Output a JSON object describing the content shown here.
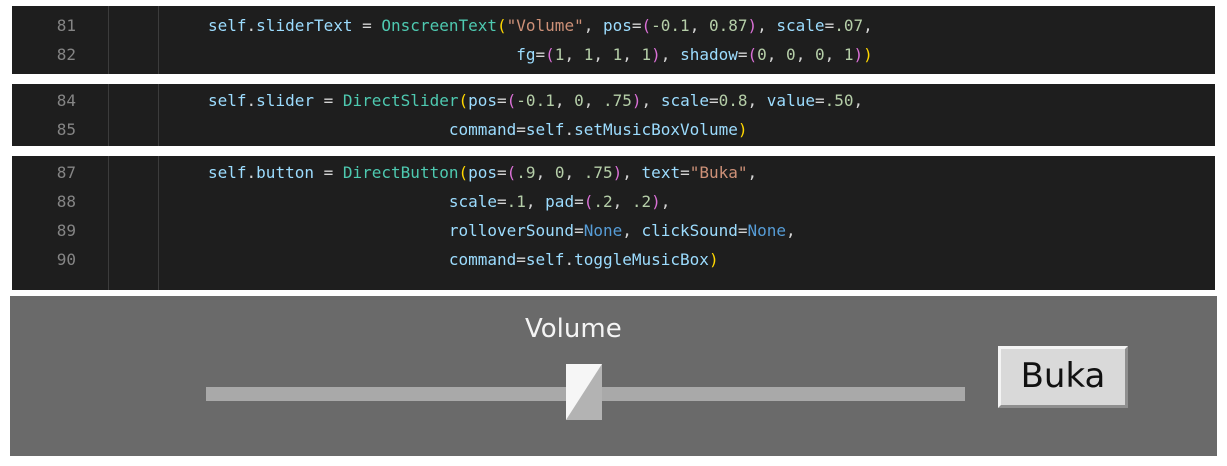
{
  "code_panels": [
    {
      "lines": [
        {
          "num": "81",
          "tokens": [
            [
              "self",
              "var"
            ],
            [
              ".",
              "op"
            ],
            [
              "sliderText",
              "var"
            ],
            [
              " = ",
              "op"
            ],
            [
              "OnscreenText",
              "cls"
            ],
            [
              "(",
              "p1"
            ],
            [
              "\"Volume\"",
              "str"
            ],
            [
              ", ",
              "op"
            ],
            [
              "pos",
              "var"
            ],
            [
              "=",
              "op"
            ],
            [
              "(",
              "p2"
            ],
            [
              "-0.1",
              "num"
            ],
            [
              ", ",
              "op"
            ],
            [
              "0.87",
              "num"
            ],
            [
              ")",
              "p2"
            ],
            [
              ", ",
              "op"
            ],
            [
              "scale",
              "var"
            ],
            [
              "=",
              "op"
            ],
            [
              ".07",
              "num"
            ],
            [
              ",",
              "op"
            ]
          ]
        },
        {
          "num": "82",
          "tokens": [
            [
              "                                ",
              "op"
            ],
            [
              "fg",
              "var"
            ],
            [
              "=",
              "op"
            ],
            [
              "(",
              "p2"
            ],
            [
              "1",
              "num"
            ],
            [
              ", ",
              "op"
            ],
            [
              "1",
              "num"
            ],
            [
              ", ",
              "op"
            ],
            [
              "1",
              "num"
            ],
            [
              ", ",
              "op"
            ],
            [
              "1",
              "num"
            ],
            [
              ")",
              "p2"
            ],
            [
              ", ",
              "op"
            ],
            [
              "shadow",
              "var"
            ],
            [
              "=",
              "op"
            ],
            [
              "(",
              "p2"
            ],
            [
              "0",
              "num"
            ],
            [
              ", ",
              "op"
            ],
            [
              "0",
              "num"
            ],
            [
              ", ",
              "op"
            ],
            [
              "0",
              "num"
            ],
            [
              ", ",
              "op"
            ],
            [
              "1",
              "num"
            ],
            [
              ")",
              "p2"
            ],
            [
              ")",
              "p1"
            ]
          ]
        }
      ]
    },
    {
      "lines": [
        {
          "num": "84",
          "tokens": [
            [
              "self",
              "var"
            ],
            [
              ".",
              "op"
            ],
            [
              "slider",
              "var"
            ],
            [
              " = ",
              "op"
            ],
            [
              "DirectSlider",
              "cls"
            ],
            [
              "(",
              "p1"
            ],
            [
              "pos",
              "var"
            ],
            [
              "=",
              "op"
            ],
            [
              "(",
              "p2"
            ],
            [
              "-0.1",
              "num"
            ],
            [
              ", ",
              "op"
            ],
            [
              "0",
              "num"
            ],
            [
              ", ",
              "op"
            ],
            [
              ".75",
              "num"
            ],
            [
              ")",
              "p2"
            ],
            [
              ", ",
              "op"
            ],
            [
              "scale",
              "var"
            ],
            [
              "=",
              "op"
            ],
            [
              "0.8",
              "num"
            ],
            [
              ", ",
              "op"
            ],
            [
              "value",
              "var"
            ],
            [
              "=",
              "op"
            ],
            [
              ".50",
              "num"
            ],
            [
              ",",
              "op"
            ]
          ]
        },
        {
          "num": "85",
          "tokens": [
            [
              "                         ",
              "op"
            ],
            [
              "command",
              "var"
            ],
            [
              "=",
              "op"
            ],
            [
              "self",
              "var"
            ],
            [
              ".",
              "op"
            ],
            [
              "setMusicBoxVolume",
              "var"
            ],
            [
              ")",
              "p1"
            ]
          ]
        }
      ]
    },
    {
      "lines": [
        {
          "num": "87",
          "tokens": [
            [
              "self",
              "var"
            ],
            [
              ".",
              "op"
            ],
            [
              "button",
              "var"
            ],
            [
              " = ",
              "op"
            ],
            [
              "DirectButton",
              "cls"
            ],
            [
              "(",
              "p1"
            ],
            [
              "pos",
              "var"
            ],
            [
              "=",
              "op"
            ],
            [
              "(",
              "p2"
            ],
            [
              ".9",
              "num"
            ],
            [
              ", ",
              "op"
            ],
            [
              "0",
              "num"
            ],
            [
              ", ",
              "op"
            ],
            [
              ".75",
              "num"
            ],
            [
              ")",
              "p2"
            ],
            [
              ", ",
              "op"
            ],
            [
              "text",
              "var"
            ],
            [
              "=",
              "op"
            ],
            [
              "\"Buka\"",
              "str"
            ],
            [
              ",",
              "op"
            ]
          ]
        },
        {
          "num": "88",
          "tokens": [
            [
              "                         ",
              "op"
            ],
            [
              "scale",
              "var"
            ],
            [
              "=",
              "op"
            ],
            [
              ".1",
              "num"
            ],
            [
              ", ",
              "op"
            ],
            [
              "pad",
              "var"
            ],
            [
              "=",
              "op"
            ],
            [
              "(",
              "p2"
            ],
            [
              ".2",
              "num"
            ],
            [
              ", ",
              "op"
            ],
            [
              ".2",
              "num"
            ],
            [
              ")",
              "p2"
            ],
            [
              ",",
              "op"
            ]
          ]
        },
        {
          "num": "89",
          "tokens": [
            [
              "                         ",
              "op"
            ],
            [
              "rolloverSound",
              "var"
            ],
            [
              "=",
              "op"
            ],
            [
              "None",
              "kw"
            ],
            [
              ", ",
              "op"
            ],
            [
              "clickSound",
              "var"
            ],
            [
              "=",
              "op"
            ],
            [
              "None",
              "kw"
            ],
            [
              ",",
              "op"
            ]
          ]
        },
        {
          "num": "90",
          "tokens": [
            [
              "                         ",
              "op"
            ],
            [
              "command",
              "var"
            ],
            [
              "=",
              "op"
            ],
            [
              "self",
              "var"
            ],
            [
              ".",
              "op"
            ],
            [
              "toggleMusicBox",
              "var"
            ],
            [
              ")",
              "p1"
            ]
          ]
        }
      ]
    }
  ],
  "gui": {
    "label": "Volume",
    "slider_value": 0.5,
    "button_label": "Buka"
  },
  "colors": {
    "editor_bg": "#1e1e1e",
    "gui_bg": "#6a6a6a"
  }
}
